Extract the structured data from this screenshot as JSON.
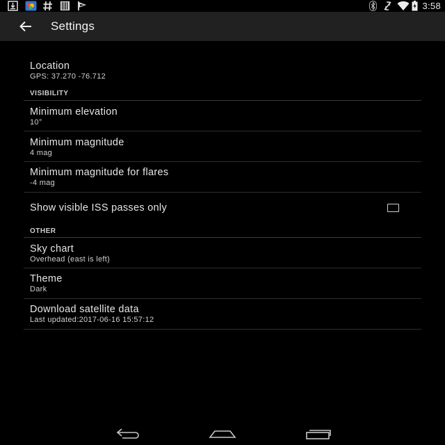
{
  "status_bar": {
    "left_icons": [
      "download-icon",
      "photos-app-icon",
      "hash-icon",
      "barcode-icon",
      "flag-icon"
    ],
    "right_icons": [
      "bluetooth-icon",
      "vibrate-off-icon",
      "wifi-icon",
      "battery-charging-icon"
    ],
    "time": "3:58"
  },
  "app_bar": {
    "back_icon": "arrow-back-icon",
    "title": "Settings"
  },
  "settings": {
    "location": {
      "title": "Location",
      "summary": "GPS: 37.270 -76.712"
    },
    "visibility": {
      "header": "VISIBILITY",
      "min_elevation": {
        "title": "Minimum elevation",
        "summary": "10°"
      },
      "min_magnitude": {
        "title": "Minimum magnitude",
        "summary": "4 mag"
      },
      "min_magnitude_flares": {
        "title": "Minimum magnitude for flares",
        "summary": "-4 mag"
      },
      "iss_only": {
        "title": "Show visible ISS passes only",
        "checked": false
      }
    },
    "other": {
      "header": "OTHER",
      "sky_chart": {
        "title": "Sky chart",
        "summary": "Overhead (east is left)"
      },
      "theme": {
        "title": "Theme",
        "summary": "Dark"
      },
      "download": {
        "title": "Download satellite data",
        "summary": "Last updated:2017-06-16 15:57:12"
      }
    }
  },
  "nav_bar": {
    "icons": [
      "nav-back-icon",
      "nav-home-icon",
      "nav-recents-icon"
    ]
  },
  "colors": {
    "background": "#000000",
    "app_bar": "#212121",
    "text_primary": "#e6e6e6",
    "divider": "#2e2e2e"
  }
}
